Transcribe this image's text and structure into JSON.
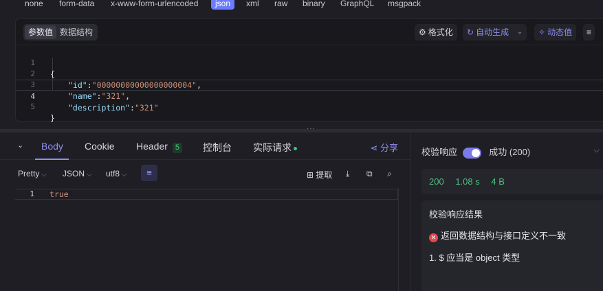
{
  "body_types": [
    "none",
    "form-data",
    "x-www-form-urlencoded",
    "json",
    "xml",
    "raw",
    "binary",
    "GraphQL",
    "msgpack"
  ],
  "request": {
    "tabs": [
      "参数值",
      "数据结构"
    ],
    "format_label": "格式化",
    "auto_generate_label": "自动生成",
    "dynamic_value_label": "动态值",
    "lines": [
      {
        "n": "1",
        "text": "{"
      },
      {
        "n": "2",
        "key": "\"id\"",
        "value": "\"00000000000000000004\"",
        "tail": ","
      },
      {
        "n": "3",
        "key": "\"name\"",
        "value": "\"321\"",
        "tail": ","
      },
      {
        "n": "4",
        "key": "\"description\"",
        "value": "\"321\"",
        "tail": ""
      },
      {
        "n": "5",
        "text": "}"
      }
    ]
  },
  "splitter_dots": "···",
  "response": {
    "tabs": {
      "body": "Body",
      "cookie": "Cookie",
      "header": "Header",
      "header_count": "5",
      "console": "控制台",
      "actual_request": "实际请求"
    },
    "share_label": "分享",
    "pretty_label": "Pretty",
    "format_label": "JSON",
    "encoding_label": "utf8",
    "extract_label": "提取",
    "line_number": "1",
    "body_text": "true"
  },
  "validation": {
    "label": "校验响应",
    "status_text": "成功 (200)",
    "status_code": "200",
    "time": "1.08 s",
    "size": "4 B",
    "result_title": "校验响应结果",
    "error_message": "返回数据结构与接口定义不一致",
    "error_detail": "1. $ 应当是 object 类型"
  },
  "colors": {
    "accent": "#8f8ff5",
    "success": "#4cc27e",
    "error": "#e5484d",
    "active_type": "#6b7cff"
  }
}
